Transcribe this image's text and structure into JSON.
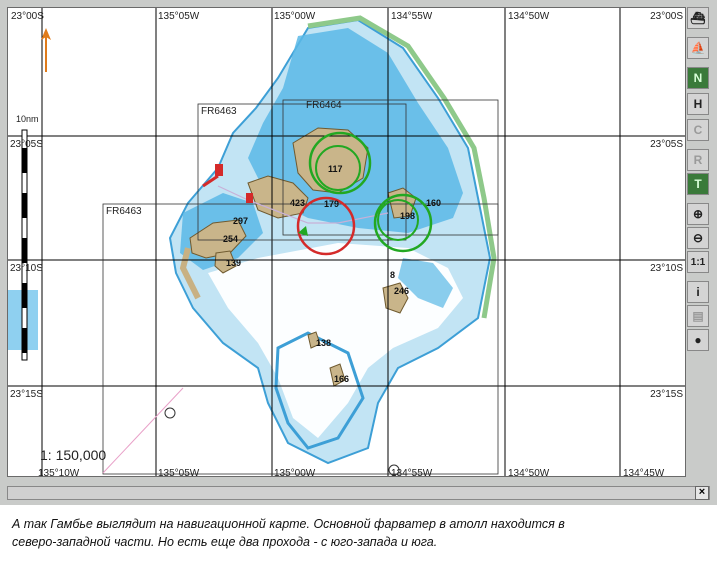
{
  "map": {
    "scale_text": "1: 150,000",
    "scale_bar_label": "10nm",
    "top_labels": [
      "23°00S",
      "135°05W",
      "135°00W",
      "134°55W",
      "134°50W",
      "23°00S"
    ],
    "bottom_labels": [
      "135°10W",
      "135°05W",
      "135°00W",
      "134°55W",
      "134°50W",
      "134°45W"
    ],
    "left_labels": [
      "23°05S",
      "23°10S",
      "23°15S"
    ],
    "right_labels": [
      "23°05S",
      "23°10S",
      "23°15S"
    ],
    "chart_labels": [
      "FR6463",
      "FR6464",
      "FR6463"
    ],
    "depths": [
      "423",
      "117",
      "179",
      "160",
      "198",
      "297",
      "254",
      "139",
      "8",
      "246",
      "138",
      "166"
    ],
    "colors": {
      "land": "#c9b58a",
      "shallow": "#5ab8e6",
      "medium": "#a7dcf2",
      "reef": "#a7d8a0",
      "green_circle": "#22a822",
      "red_circle": "#d42a2a",
      "grid": "#000000",
      "panel": "#c9cbc9",
      "toolbar_active": "#3a7a3a"
    }
  },
  "toolbar": {
    "buttons": [
      {
        "name": "ship-icon",
        "glyph": "⛴"
      },
      {
        "name": "ship-outline-icon",
        "glyph": "⛵"
      },
      {
        "name": "north-up-icon",
        "glyph": "N"
      },
      {
        "name": "head-up-icon",
        "glyph": "H"
      },
      {
        "name": "course-up-icon",
        "glyph": "C"
      },
      {
        "name": "relative-motion-icon",
        "glyph": "R"
      },
      {
        "name": "true-motion-icon",
        "glyph": "T"
      },
      {
        "name": "zoom-in-icon",
        "glyph": "⊕"
      },
      {
        "name": "zoom-out-icon",
        "glyph": "⊖"
      },
      {
        "name": "one-to-one-icon",
        "glyph": "1:1"
      },
      {
        "name": "info-icon",
        "glyph": "i"
      },
      {
        "name": "pick-report-icon",
        "glyph": "▤"
      },
      {
        "name": "center-icon",
        "glyph": "●"
      }
    ]
  },
  "window": {
    "close_glyph": "×",
    "scroll_glyph": "◄"
  },
  "caption": {
    "line1": "А так Гамбье выглядит на навигационной карте.  Основной фарватер в атолл находится в",
    "line2": "северо-западной части. Но есть еще два прохода - с юго-запада и юга."
  }
}
